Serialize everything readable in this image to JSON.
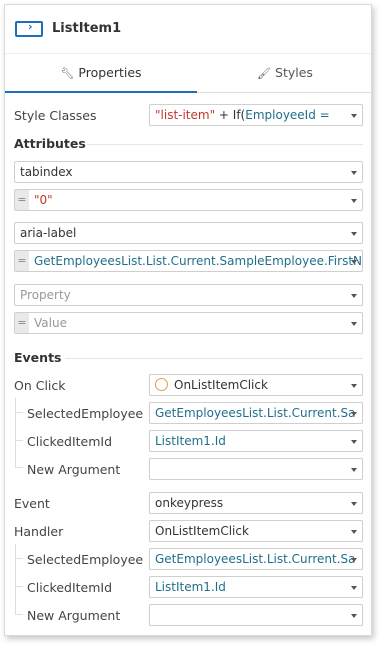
{
  "header": {
    "title": "ListItem1",
    "icon": "widget-icon"
  },
  "tabs": [
    {
      "label": "Properties",
      "icon": "wrench-icon",
      "active": true
    },
    {
      "label": "Styles",
      "icon": "brush-icon",
      "active": false
    }
  ],
  "style_classes": {
    "label": "Style Classes",
    "value_string": "\"list-item\"",
    "value_rest_plain": " + If(",
    "value_rest_expr": "EmployeeId ="
  },
  "attributes": {
    "section_label": "Attributes",
    "items": [
      {
        "name": "tabindex",
        "value": "\"0\""
      },
      {
        "name": "aria-label",
        "value": "GetEmployeesList.List.Current.SampleEmployee.FirstN"
      }
    ],
    "empty_name_placeholder": "Property",
    "empty_value_placeholder": "Value",
    "equals": "="
  },
  "events": {
    "section_label": "Events",
    "on_click": {
      "label": "On Click",
      "handler": "OnListItemClick",
      "args": [
        {
          "label": "SelectedEmployee",
          "value": "GetEmployeesList.List.Current.Sa"
        },
        {
          "label": "ClickedItemId",
          "value": "ListItem1.Id"
        },
        {
          "label": "New Argument",
          "value": ""
        }
      ]
    },
    "event": {
      "label": "Event",
      "value": "onkeypress",
      "handler_label": "Handler",
      "handler_value": "OnListItemClick",
      "args": [
        {
          "label": "SelectedEmployee",
          "value": "GetEmployeesList.List.Current.Sa"
        },
        {
          "label": "ClickedItemId",
          "value": "ListItem1.Id"
        },
        {
          "label": "New Argument",
          "value": ""
        }
      ]
    }
  }
}
